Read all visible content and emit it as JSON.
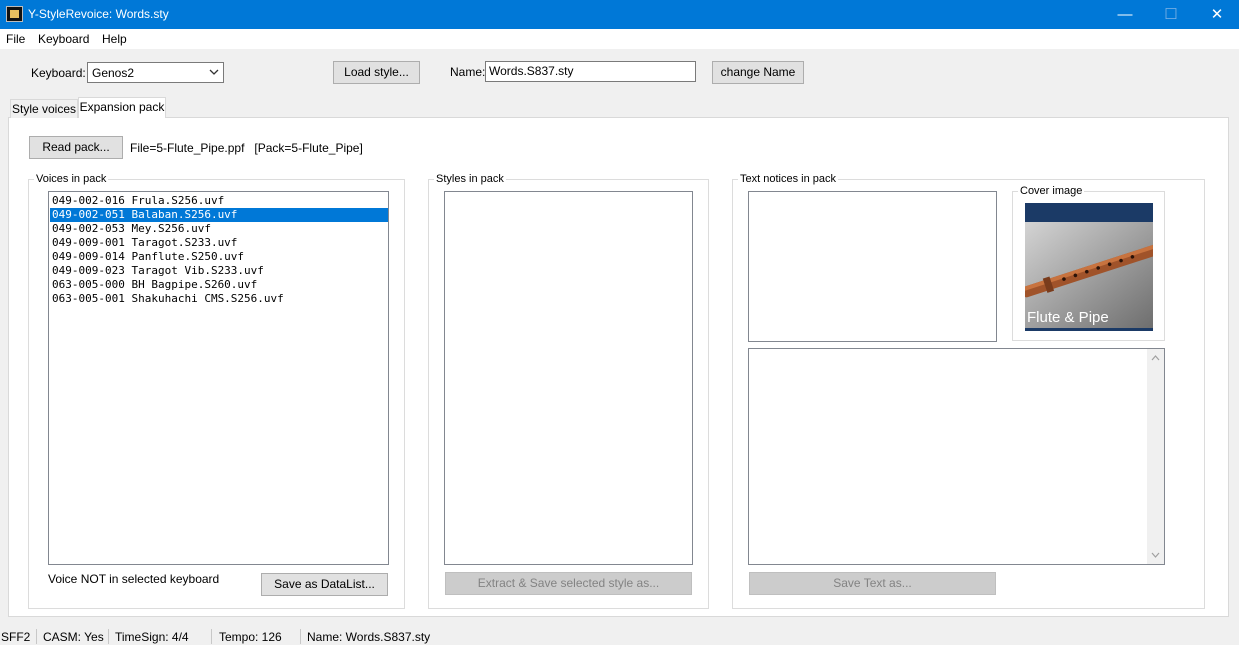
{
  "window": {
    "title": "Y-StyleRevoice: Words.sty",
    "controls": {
      "minimize": "—",
      "maximize": "☐",
      "close": "✕"
    }
  },
  "menu": [
    "File",
    "Keyboard",
    "Help"
  ],
  "toolbar": {
    "keyboard_label": "Keyboard:",
    "keyboard_value": "Genos2",
    "load_style_label": "Load style...",
    "name_label": "Name:",
    "name_value": "Words.S837.sty",
    "change_name_label": "change Name"
  },
  "tabs": [
    {
      "label": "Style voices",
      "active": false
    },
    {
      "label": "Expansion pack",
      "active": true
    }
  ],
  "expansion_pack": {
    "read_pack_label": "Read pack...",
    "file_info": "File=5-Flute_Pipe.ppf   [Pack=5-Flute_Pipe]",
    "voices": {
      "group_title": "Voices in pack",
      "items": [
        "049-002-016 Frula.S256.uvf",
        "049-002-051 Balaban.S256.uvf",
        "049-002-053 Mey.S256.uvf",
        "049-009-001 Taragot.S233.uvf",
        "049-009-014 Panflute.S250.uvf",
        "049-009-023 Taragot Vib.S233.uvf",
        "063-005-000 BH Bagpipe.S260.uvf",
        "063-005-001 Shakuhachi CMS.S256.uvf"
      ],
      "selected_index": 1,
      "note": "Voice NOT in selected keyboard",
      "save_datalist_label": "Save as DataList..."
    },
    "styles": {
      "group_title": "Styles in pack",
      "extract_label": "Extract & Save selected style as..."
    },
    "text_notices": {
      "group_title": "Text notices in pack",
      "cover_title": "Cover image",
      "cover_caption": "Flute & Pipe",
      "save_text_label": "Save Text as..."
    }
  },
  "status": [
    "SFF2",
    "CASM: Yes",
    "TimeSign: 4/4",
    "Tempo: 126",
    "Name: Words.S837.sty"
  ],
  "colors": {
    "titlebar": "#0078d7",
    "selection": "#0078d7",
    "cover_bg": "#1b3a66"
  }
}
